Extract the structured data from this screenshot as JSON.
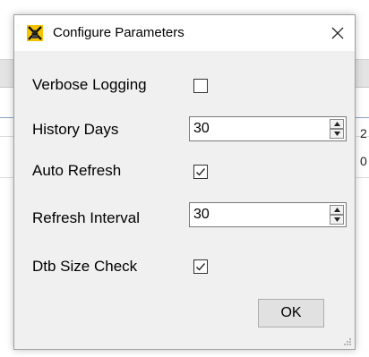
{
  "dialog": {
    "title": "Configure Parameters",
    "icon": "app-icon",
    "close_icon": "close-icon"
  },
  "fields": {
    "verbose_logging": {
      "label": "Verbose Logging",
      "checked": false
    },
    "history_days": {
      "label": "History Days",
      "value": "30"
    },
    "auto_refresh": {
      "label": "Auto Refresh",
      "checked": true
    },
    "refresh_interval": {
      "label": "Refresh Interval",
      "value": "30"
    },
    "dtb_size_check": {
      "label": "Dtb Size Check",
      "checked": true
    }
  },
  "buttons": {
    "ok": "OK"
  },
  "background": {
    "glyph_1": "2",
    "glyph_2": "0"
  },
  "colors": {
    "dialog_bg": "#f0f0f0",
    "titlebar_bg": "#ffffff",
    "border": "#a0a0a0"
  }
}
